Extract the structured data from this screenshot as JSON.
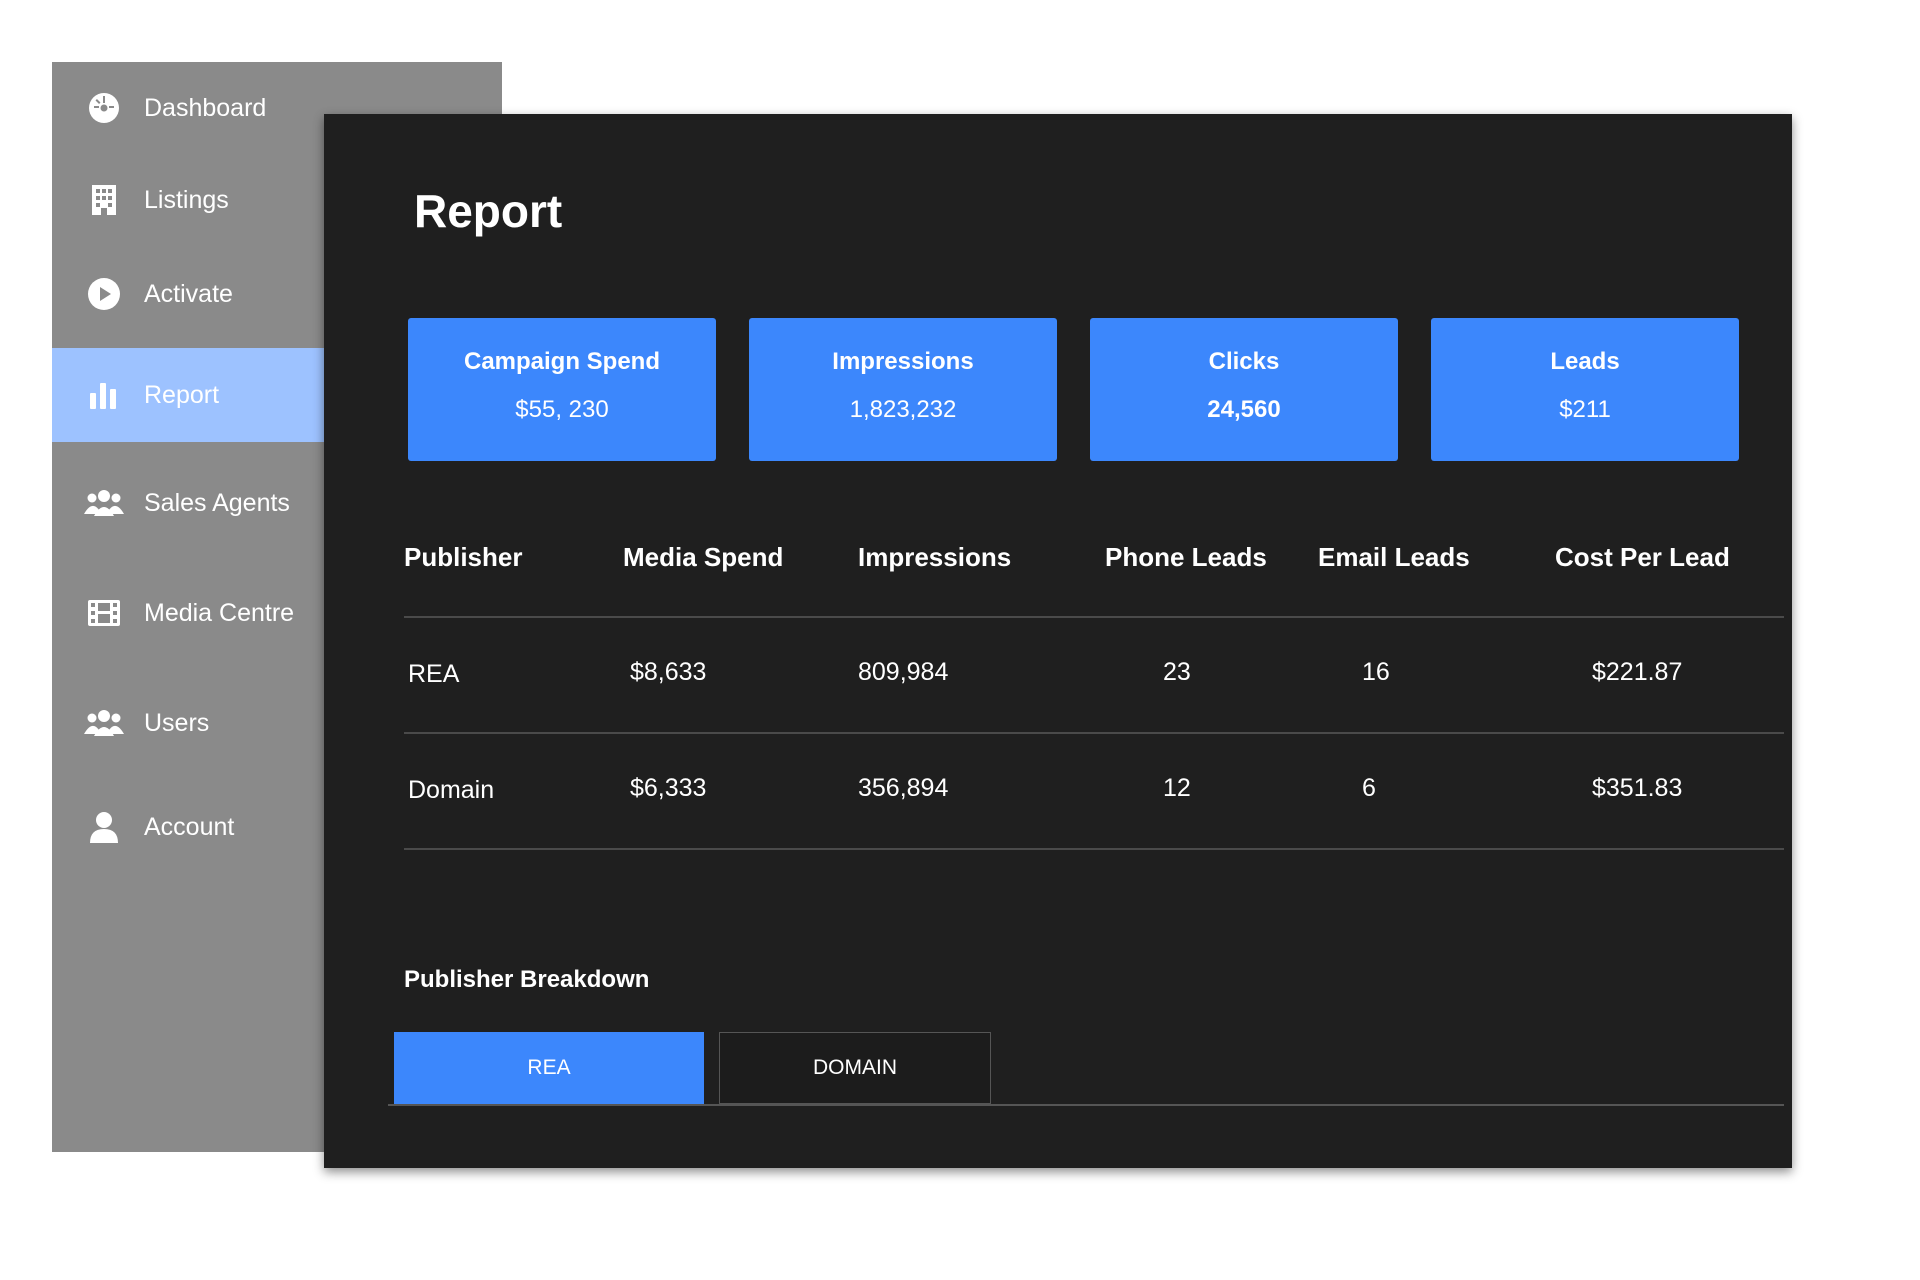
{
  "sidebar": {
    "items": [
      {
        "label": "Dashboard",
        "icon": "dashboard-icon"
      },
      {
        "label": "Listings",
        "icon": "building-icon"
      },
      {
        "label": "Activate",
        "icon": "play-icon"
      },
      {
        "label": "Report",
        "icon": "bar-chart-icon",
        "active": true
      },
      {
        "label": "Sales Agents",
        "icon": "users-icon"
      },
      {
        "label": "Media Centre",
        "icon": "film-icon"
      },
      {
        "label": "Users",
        "icon": "users-icon"
      },
      {
        "label": "Account",
        "icon": "user-icon"
      }
    ]
  },
  "main": {
    "title": "Report",
    "cards": [
      {
        "label": "Campaign Spend",
        "value": "$55, 230"
      },
      {
        "label": "Impressions",
        "value": "1,823,232"
      },
      {
        "label": "Clicks",
        "value": "24,560"
      },
      {
        "label": "Leads",
        "value": "$211"
      }
    ],
    "table": {
      "headers": [
        "Publisher",
        "Media Spend",
        "Impressions",
        "Phone Leads",
        "Email Leads",
        "Cost Per Lead"
      ],
      "rows": [
        [
          "REA",
          "$8,633",
          "809,984",
          "23",
          "16",
          "$221.87"
        ],
        [
          "Domain",
          "$6,333",
          "356,894",
          "12",
          "6",
          "$351.83"
        ]
      ]
    },
    "breakdown": {
      "title": "Publisher Breakdown",
      "tabs": [
        {
          "label": "REA",
          "active": true
        },
        {
          "label": "DOMAIN",
          "active": false
        }
      ]
    }
  },
  "colors": {
    "sidebar_bg": "#8a8a8a",
    "sidebar_active": "#9dc2ff",
    "panel_bg": "#1f1f1f",
    "accent": "#3c87fc"
  }
}
